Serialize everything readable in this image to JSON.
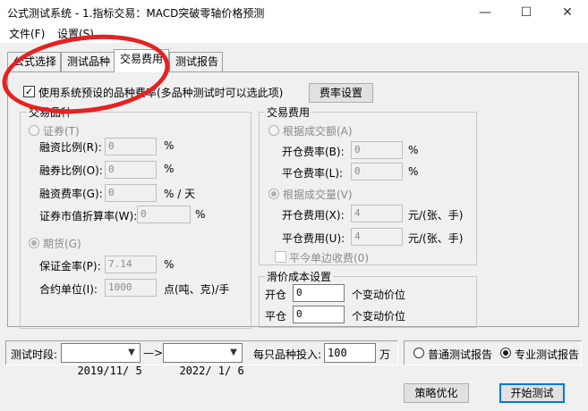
{
  "window": {
    "title": "公式测试系统 - 1.指标交易：MACD突破零轴价格预测",
    "minimize_glyph": "—",
    "maximize_glyph": "☐",
    "close_glyph": "✕"
  },
  "menu": {
    "file": "文件(F)",
    "settings": "设置(S)"
  },
  "tabs": [
    {
      "label": "公式选择"
    },
    {
      "label": "测试品种"
    },
    {
      "label": "交易费用"
    },
    {
      "label": "测试报告"
    }
  ],
  "use_preset": {
    "label": "使用系统预设的品种费率(多品种测试时可以选此项)",
    "checked": true
  },
  "fee_settings_button": "费率设置",
  "product": {
    "group_title": "交易品种",
    "securities": {
      "label": "证券(T)",
      "margin_ratio": {
        "label": "融资比例(R):",
        "value": "0",
        "unit": "%"
      },
      "short_ratio": {
        "label": "融券比例(O):",
        "value": "0",
        "unit": "%"
      },
      "margin_fee": {
        "label": "融资费率(G):",
        "value": "0",
        "unit": "% / 天"
      },
      "discount_rate": {
        "label": "证券市值折算率(W):",
        "value": "0",
        "unit": "%"
      }
    },
    "futures": {
      "label": "期货(G)",
      "deposit_rate": {
        "label": "保证金率(P):",
        "value": "7.14",
        "unit": "%"
      },
      "contract_unit": {
        "label": "合约单位(I):",
        "value": "1000",
        "unit": "点(吨、克)/手"
      }
    }
  },
  "fees": {
    "group_title": "交易费用",
    "by_amount": {
      "label": "根据成交额(A)",
      "open_rate": {
        "label": "开仓费率(B):",
        "value": "0",
        "unit": "%"
      },
      "close_rate": {
        "label": "平仓费率(L):",
        "value": "0",
        "unit": "%"
      }
    },
    "by_volume": {
      "label": "根据成交量(V)",
      "open_fee": {
        "label": "开仓费用(X):",
        "value": "4",
        "unit": "元/(张、手)"
      },
      "close_fee": {
        "label": "平仓费用(U):",
        "value": "4",
        "unit": "元/(张、手)"
      }
    },
    "one_side": {
      "label": "平今单边收费(0)",
      "checked": false
    }
  },
  "slippage": {
    "group_title": "滑价成本设置",
    "open": {
      "label": "开仓",
      "value": "0",
      "unit": "个变动价位"
    },
    "close": {
      "label": "平仓",
      "value": "0",
      "unit": "个变动价位"
    }
  },
  "bottom": {
    "period_label": "测试时段:",
    "start_date": "2019/11/ 5",
    "arrow": "—>",
    "end_date": "2022/ 1/ 6",
    "invest_label": "每只品种投入:",
    "invest_value": "100",
    "invest_unit": "万",
    "report_normal": "普通测试报告",
    "report_pro": "专业测试报告",
    "optimize_button": "策略优化",
    "start_button": "开始测试"
  }
}
